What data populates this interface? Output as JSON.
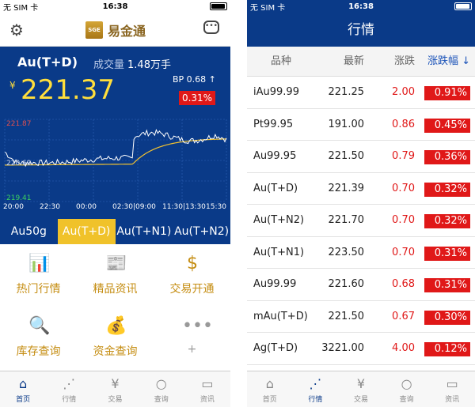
{
  "status": {
    "carrier": "无 SIM 卡",
    "time": "16:38"
  },
  "left": {
    "brand": {
      "logo": "SGE",
      "name": "易金通"
    },
    "quote": {
      "symbol": "Au(T+D)",
      "volume_label": "成交量",
      "volume_value": "1.48万手",
      "currency": "¥",
      "price": "221.37",
      "bp": "BP 0.68",
      "bp_arrow": "↑",
      "change": "0.31%"
    },
    "chart_data": {
      "type": "line",
      "title": "",
      "xlabel": "",
      "ylabel": "",
      "ylim": [
        219.41,
        221.87
      ],
      "y_ticks": [
        "221.87",
        "220.69",
        "219.41"
      ],
      "x_ticks": [
        "20:00",
        "22:30",
        "00:00",
        "02:30|09:00",
        "11:30|13:30",
        "15:30"
      ],
      "colors": {
        "price": "#ffffff",
        "average": "#f2c230",
        "grid": "#2f63b7"
      }
    },
    "tabs": [
      {
        "label": "Au50g"
      },
      {
        "label": "Au(T+D)"
      },
      {
        "label": "Au(T+N1)"
      },
      {
        "label": "Au(T+N2)"
      }
    ],
    "grid": [
      {
        "label": "热门行情",
        "icon": "bar-chart-icon"
      },
      {
        "label": "精品资讯",
        "icon": "newspaper-icon"
      },
      {
        "label": "交易开通",
        "icon": "dollar-coin-icon"
      },
      {
        "label": "库存查询",
        "icon": "magnifier-icon"
      },
      {
        "label": "资金查询",
        "icon": "money-bag-icon"
      },
      {
        "label": "+",
        "icon": "more-dots-icon"
      }
    ],
    "tabbar": [
      {
        "label": "首页",
        "icon": "home-icon"
      },
      {
        "label": "行情",
        "icon": "trend-icon"
      },
      {
        "label": "交易",
        "icon": "yen-icon"
      },
      {
        "label": "查询",
        "icon": "search-icon"
      },
      {
        "label": "资讯",
        "icon": "news-icon"
      }
    ]
  },
  "right": {
    "title": "行情",
    "columns": [
      "品种",
      "最新",
      "涨跌",
      "涨跌幅 ↓"
    ],
    "rows": [
      {
        "name": "iAu99.99",
        "last": "221.25",
        "chg": "2.00",
        "pct": "0.91%"
      },
      {
        "name": "Pt99.95",
        "last": "191.00",
        "chg": "0.86",
        "pct": "0.45%"
      },
      {
        "name": "Au99.95",
        "last": "221.50",
        "chg": "0.79",
        "pct": "0.36%"
      },
      {
        "name": "Au(T+D)",
        "last": "221.39",
        "chg": "0.70",
        "pct": "0.32%"
      },
      {
        "name": "Au(T+N2)",
        "last": "221.70",
        "chg": "0.70",
        "pct": "0.32%"
      },
      {
        "name": "Au(T+N1)",
        "last": "223.50",
        "chg": "0.70",
        "pct": "0.31%"
      },
      {
        "name": "Au99.99",
        "last": "221.60",
        "chg": "0.68",
        "pct": "0.31%"
      },
      {
        "name": "mAu(T+D)",
        "last": "221.50",
        "chg": "0.67",
        "pct": "0.30%"
      },
      {
        "name": "Ag(T+D)",
        "last": "3221.00",
        "chg": "4.00",
        "pct": "0.12%"
      }
    ],
    "tabbar": [
      {
        "label": "首页",
        "icon": "home-icon"
      },
      {
        "label": "行情",
        "icon": "trend-icon"
      },
      {
        "label": "交易",
        "icon": "yen-icon"
      },
      {
        "label": "查询",
        "icon": "search-icon"
      },
      {
        "label": "资讯",
        "icon": "news-icon"
      }
    ]
  }
}
